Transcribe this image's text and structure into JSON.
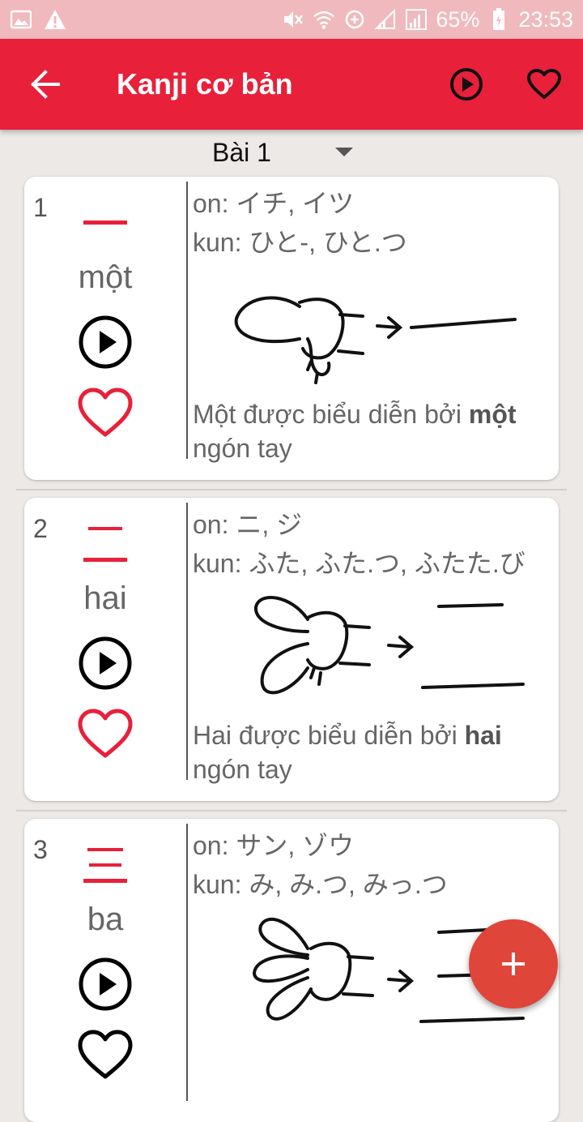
{
  "status_bar": {
    "battery": "65%",
    "time": "23:53"
  },
  "app_bar": {
    "title": "Kanji cơ bản"
  },
  "lesson_selector": {
    "selected": "Bài 1"
  },
  "colors": {
    "primary": "#e8203a",
    "status_bar": "#f0b9bd",
    "kanji": "#e8203a",
    "fab": "#e0453a"
  },
  "cards": [
    {
      "number": "1",
      "kanji": "一",
      "meaning": "một",
      "on": "on:  イチ, イツ",
      "kun": "kun: ひと-, ひと.つ",
      "desc_pre": "Một được biểu diễn bởi ",
      "desc_bold": "một",
      "desc_post": " ngón tay"
    },
    {
      "number": "2",
      "kanji": "二",
      "meaning": "hai",
      "on": "on:  ニ, ジ",
      "kun": "kun: ふた, ふた.つ, ふたた.び",
      "desc_pre": "Hai được biểu diễn bởi ",
      "desc_bold": "hai",
      "desc_post": " ngón tay"
    },
    {
      "number": "3",
      "kanji": "三",
      "meaning": "ba",
      "on": "on:  サン, ゾウ",
      "kun": "kun: み, み.つ, みっ.つ",
      "desc_pre": "",
      "desc_bold": "",
      "desc_post": ""
    }
  ],
  "icons": {
    "back": "arrow-left-icon",
    "play_all": "play-circle-icon",
    "favorites": "heart-outline-icon",
    "add": "plus-icon"
  }
}
